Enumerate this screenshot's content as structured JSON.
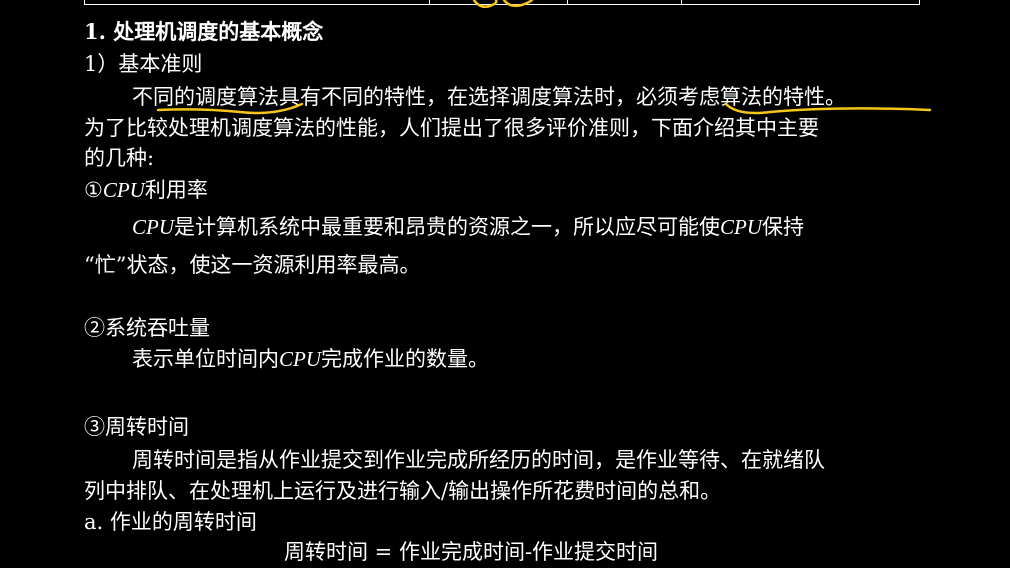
{
  "section_title": "1. 处理机调度的基本概念",
  "subsection_title": "1）基本准则",
  "intro": {
    "line1": "不同的调度算法具有不同的特性，在选择调度算法时，必须考虑算法的特性。",
    "line2": "为了比较处理机调度算法的性能，人们提出了很多评价准则，下面介绍其中主要",
    "line3": "的几种:"
  },
  "criteria": [
    {
      "marker": "①",
      "name_em": "CPU",
      "name_rest": "利用率",
      "desc_em1": "CPU",
      "desc_mid": "是计算机系统中最重要和昂贵的资源之一，所以应尽可能使",
      "desc_em2": "CPU",
      "desc_end": "保持",
      "desc_line2": "“忙”状态，使这一资源利用率最高。"
    },
    {
      "marker": "②",
      "name": "系统吞吐量",
      "desc_pre": "表示单位时间内",
      "desc_em": "CPU",
      "desc_post": "完成作业的数量。"
    },
    {
      "marker": "③",
      "name": "周转时间",
      "desc_line1": "周转时间是指从作业提交到作业完成所经历的时间，是作业等待、在就绪队",
      "desc_line2": "列中排队、在处理机上运行及进行输入/输出操作所花费时间的总和。",
      "sub_item": "a. 作业的周转时间",
      "formula": "周转时间 = 作业完成时间-作业提交时间"
    }
  ],
  "colors": {
    "background": "#000000",
    "text": "#ffffff",
    "annotation": "#f5c518"
  }
}
